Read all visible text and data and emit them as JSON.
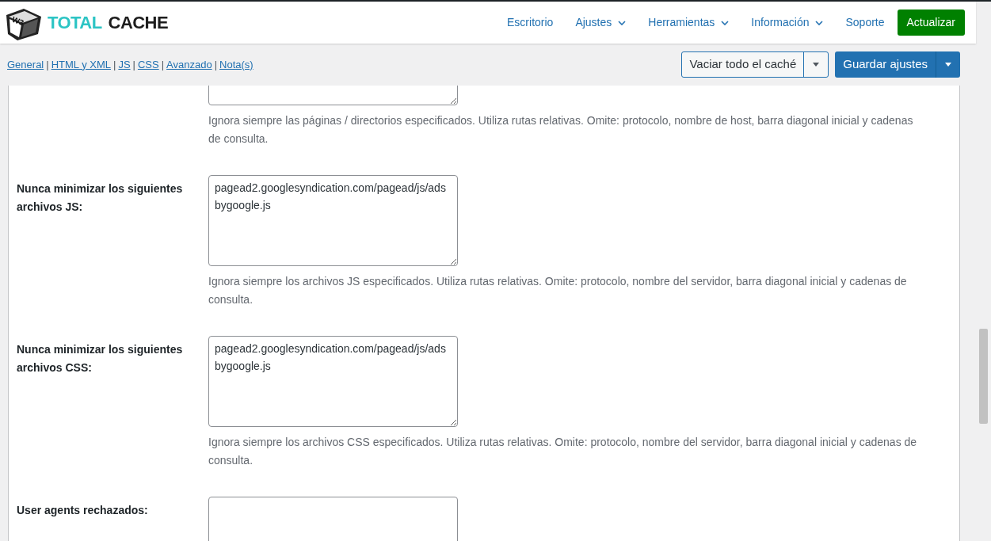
{
  "header": {
    "logo_badge": "W3",
    "logo_word1": "TOTAL",
    "logo_word2": "CACHE",
    "nav": [
      {
        "label": "Escritorio",
        "dropdown": false
      },
      {
        "label": "Ajustes",
        "dropdown": true
      },
      {
        "label": "Herramientas",
        "dropdown": true
      },
      {
        "label": "Información",
        "dropdown": true
      },
      {
        "label": "Soporte",
        "dropdown": false
      }
    ],
    "update_button": "Actualizar"
  },
  "subnav": {
    "separator": "|",
    "links": [
      "General",
      "HTML y XML",
      "JS",
      "CSS",
      "Avanzado",
      "Nota(s)"
    ]
  },
  "actions": {
    "flush_button": "Vaciar todo el caché",
    "save_button": "Guardar ajustes"
  },
  "settings": [
    {
      "kind": "cut_top",
      "description": "Ignora siempre las páginas / directorios especificados. Utiliza rutas relativas. Omite: protocolo, nombre de host, barra diagonal inicial y cadenas de consulta."
    },
    {
      "kind": "full",
      "label": "Nunca minimizar los siguientes archivos JS:",
      "value": "pagead2.googlesyndication.com/pagead/js/adsbygoogle.js",
      "description": "Ignora siempre los archivos JS especificados. Utiliza rutas relativas. Omite: protocolo, nombre del servidor, barra diagonal inicial y cadenas de consulta."
    },
    {
      "kind": "full",
      "label": "Nunca minimizar los siguientes archivos CSS:",
      "value": "pagead2.googlesyndication.com/pagead/js/adsbygoogle.js",
      "description": "Ignora siempre los archivos CSS especificados. Utiliza rutas relativas. Omite: protocolo, nombre del servidor, barra diagonal inicial y cadenas de consulta."
    },
    {
      "kind": "cut_bottom",
      "label": "User agents rechazados:"
    }
  ]
}
